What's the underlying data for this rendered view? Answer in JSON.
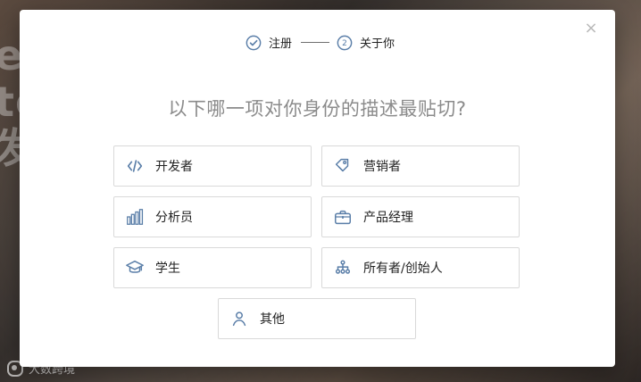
{
  "background": {
    "text_lines": [
      "el",
      "te",
      "发"
    ],
    "watermark": "大数跨境"
  },
  "modal": {
    "steps": [
      {
        "label": "注册"
      },
      {
        "label": "关于你",
        "number": "2"
      }
    ],
    "title": "以下哪一项对你身份的描述最贴切?",
    "close_symbol": "×",
    "options": [
      {
        "id": "developer",
        "label": "开发者",
        "icon": "code-icon"
      },
      {
        "id": "marketer",
        "label": "营销者",
        "icon": "tags-icon"
      },
      {
        "id": "analyst",
        "label": "分析员",
        "icon": "bar-chart-icon"
      },
      {
        "id": "pm",
        "label": "产品经理",
        "icon": "briefcase-icon"
      },
      {
        "id": "student",
        "label": "学生",
        "icon": "graduation-cap-icon"
      },
      {
        "id": "owner",
        "label": "所有者/创始人",
        "icon": "org-chart-icon"
      },
      {
        "id": "other",
        "label": "其他",
        "icon": "user-icon"
      }
    ]
  },
  "colors": {
    "accent": "#5a7ea8",
    "border": "#d9d9d9",
    "title": "#8b8b8b"
  }
}
